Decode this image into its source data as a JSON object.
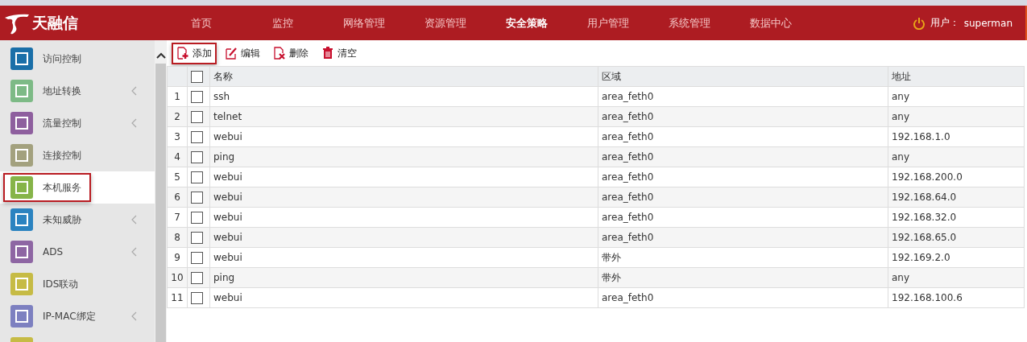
{
  "header": {
    "brand": "天融信",
    "nav": [
      {
        "label": "首页",
        "selected": false
      },
      {
        "label": "监控",
        "selected": false
      },
      {
        "label": "网络管理",
        "selected": false
      },
      {
        "label": "资源管理",
        "selected": false
      },
      {
        "label": "安全策略",
        "selected": true
      },
      {
        "label": "用户管理",
        "selected": false
      },
      {
        "label": "系统管理",
        "selected": false
      },
      {
        "label": "数据中心",
        "selected": false
      }
    ],
    "user_label": "用户：",
    "user": "superman"
  },
  "sidebar": {
    "items": [
      {
        "label": "访问控制",
        "color": "#1a6fa8",
        "has_submenu": false,
        "selected": false
      },
      {
        "label": "地址转换",
        "color": "#7dba86",
        "has_submenu": true,
        "selected": false
      },
      {
        "label": "流量控制",
        "color": "#8e5f9e",
        "has_submenu": true,
        "selected": false
      },
      {
        "label": "连接控制",
        "color": "#a3a17e",
        "has_submenu": false,
        "selected": false
      },
      {
        "label": "本机服务",
        "color": "#86b449",
        "has_submenu": false,
        "selected": true
      },
      {
        "label": "未知威胁",
        "color": "#2b83c0",
        "has_submenu": true,
        "selected": false
      },
      {
        "label": "ADS",
        "color": "#8e66a3",
        "has_submenu": true,
        "selected": false
      },
      {
        "label": "IDS联动",
        "color": "#c6bb45",
        "has_submenu": false,
        "selected": false
      },
      {
        "label": "IP-MAC绑定",
        "color": "#7d80c0",
        "has_submenu": true,
        "selected": false
      },
      {
        "color": "#c6bb45",
        "has_submenu": false,
        "selected": false
      }
    ]
  },
  "toolbar": [
    {
      "kind": "add",
      "label": "添加",
      "selected": true
    },
    {
      "kind": "edit",
      "label": "编辑",
      "selected": false
    },
    {
      "kind": "delete",
      "label": "删除",
      "selected": false
    },
    {
      "kind": "clear",
      "label": "清空",
      "selected": false
    }
  ],
  "table": {
    "select_all_checked": false,
    "columns": [
      "名称",
      "区域",
      "地址"
    ],
    "rows": [
      {
        "index": "1",
        "checked": false,
        "cells": [
          "ssh",
          "area_feth0",
          "any"
        ]
      },
      {
        "index": "2",
        "checked": false,
        "cells": [
          "telnet",
          "area_feth0",
          "any"
        ]
      },
      {
        "index": "3",
        "checked": false,
        "cells": [
          "webui",
          "area_feth0",
          "192.168.1.0"
        ]
      },
      {
        "index": "4",
        "checked": false,
        "cells": [
          "ping",
          "area_feth0",
          "any"
        ]
      },
      {
        "index": "5",
        "checked": false,
        "cells": [
          "webui",
          "area_feth0",
          "192.168.200.0"
        ]
      },
      {
        "index": "6",
        "checked": false,
        "cells": [
          "webui",
          "area_feth0",
          "192.168.64.0"
        ]
      },
      {
        "index": "7",
        "checked": false,
        "cells": [
          "webui",
          "area_feth0",
          "192.168.32.0"
        ]
      },
      {
        "index": "8",
        "checked": false,
        "cells": [
          "webui",
          "area_feth0",
          "192.168.65.0"
        ]
      },
      {
        "index": "9",
        "checked": false,
        "cells": [
          "webui",
          "带外",
          "192.169.2.0"
        ]
      },
      {
        "index": "10",
        "checked": false,
        "cells": [
          "ping",
          "带外",
          "any"
        ]
      },
      {
        "index": "11",
        "checked": false,
        "cells": [
          "webui",
          "area_feth0",
          "192.168.100.6"
        ]
      }
    ]
  }
}
